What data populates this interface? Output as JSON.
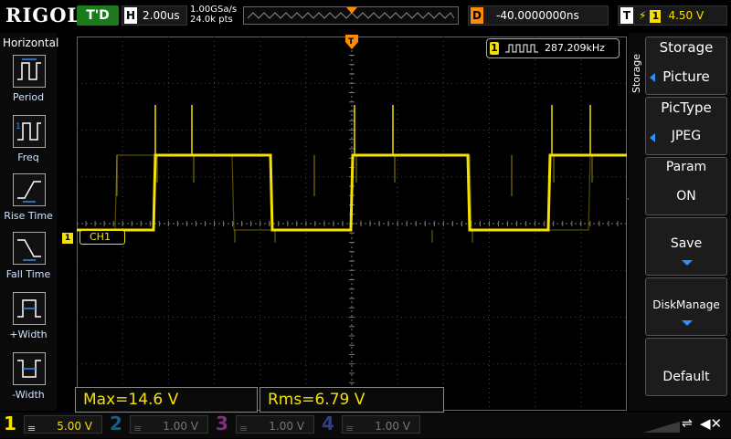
{
  "header": {
    "logo": "RIGOL",
    "trigger_state": "T'D",
    "timebase_label": "H",
    "timebase": "2.00us",
    "sample_rate": "1.00GSa/s",
    "memory_depth": "24.0k pts",
    "delay_label": "D",
    "delay": "-40.0000000ns",
    "trigger_label": "T",
    "trigger_edge": "rising-edge-icon",
    "trigger_source": "1",
    "trigger_level": "4.50 V"
  },
  "left_menu": {
    "title": "Horizontal",
    "items": [
      {
        "label": "Period",
        "icon": "period-icon"
      },
      {
        "label": "Freq",
        "icon": "freq-icon"
      },
      {
        "label": "Rise Time",
        "icon": "rise-time-icon"
      },
      {
        "label": "Fall Time",
        "icon": "fall-time-icon"
      },
      {
        "label": "+Width",
        "icon": "positive-width-icon"
      },
      {
        "label": "-Width",
        "icon": "negative-width-icon"
      }
    ]
  },
  "right_menu": {
    "title": "Storage",
    "side_label": "Storage",
    "items": [
      {
        "label": "Picture"
      },
      {
        "title": "PicType",
        "value": "JPEG"
      },
      {
        "title": "Param",
        "value": "ON"
      },
      {
        "label": "Save"
      },
      {
        "label": "DiskManage"
      },
      {
        "label": "Default"
      }
    ]
  },
  "display": {
    "channel_label": "CH1",
    "channel_marker": "1",
    "freq_source": "1",
    "frequency": "287.209kHz"
  },
  "measurements": {
    "max": "Max=14.6 V",
    "rms": "Rms=6.79 V"
  },
  "channels": [
    {
      "num": "1",
      "scale": "5.00 V",
      "color": "#f5e000",
      "active": true
    },
    {
      "num": "2",
      "scale": "1.00 V",
      "color": "#00b4ff",
      "active": false
    },
    {
      "num": "3",
      "scale": "1.00 V",
      "color": "#ff40ff",
      "active": false
    },
    {
      "num": "4",
      "scale": "1.00 V",
      "color": "#4060ff",
      "active": false
    }
  ],
  "colors": {
    "ch1": "#f5e000",
    "trigger": "#ff8c00",
    "accent_blue": "#2a8fff"
  }
}
